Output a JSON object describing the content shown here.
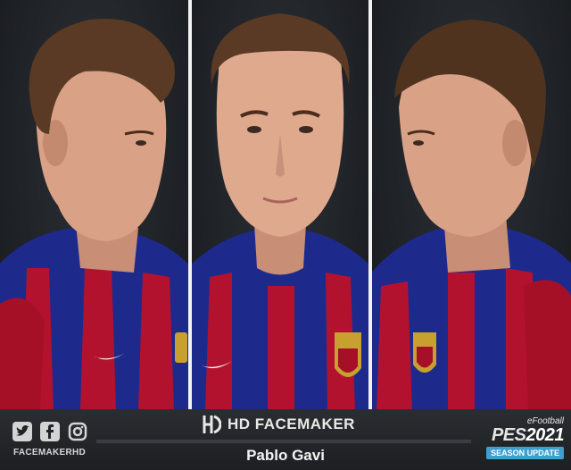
{
  "footer": {
    "handle": "FACEMAKERHD",
    "brand": "HD FACEMAKER",
    "player_name": "Pablo Gavi",
    "game_brand": "eFootball",
    "game_title": "PES",
    "game_year": "2021",
    "game_edition": "SEASON UPDATE",
    "social_icons": [
      "twitter-icon",
      "facebook-icon",
      "instagram-icon"
    ]
  },
  "images": [
    "left-profile-view",
    "front-view",
    "right-profile-view"
  ],
  "colors": {
    "jersey_blue": "#1d2a8c",
    "jersey_red": "#b3122e",
    "accent": "#3d9fd0",
    "background": "#1f2226"
  }
}
